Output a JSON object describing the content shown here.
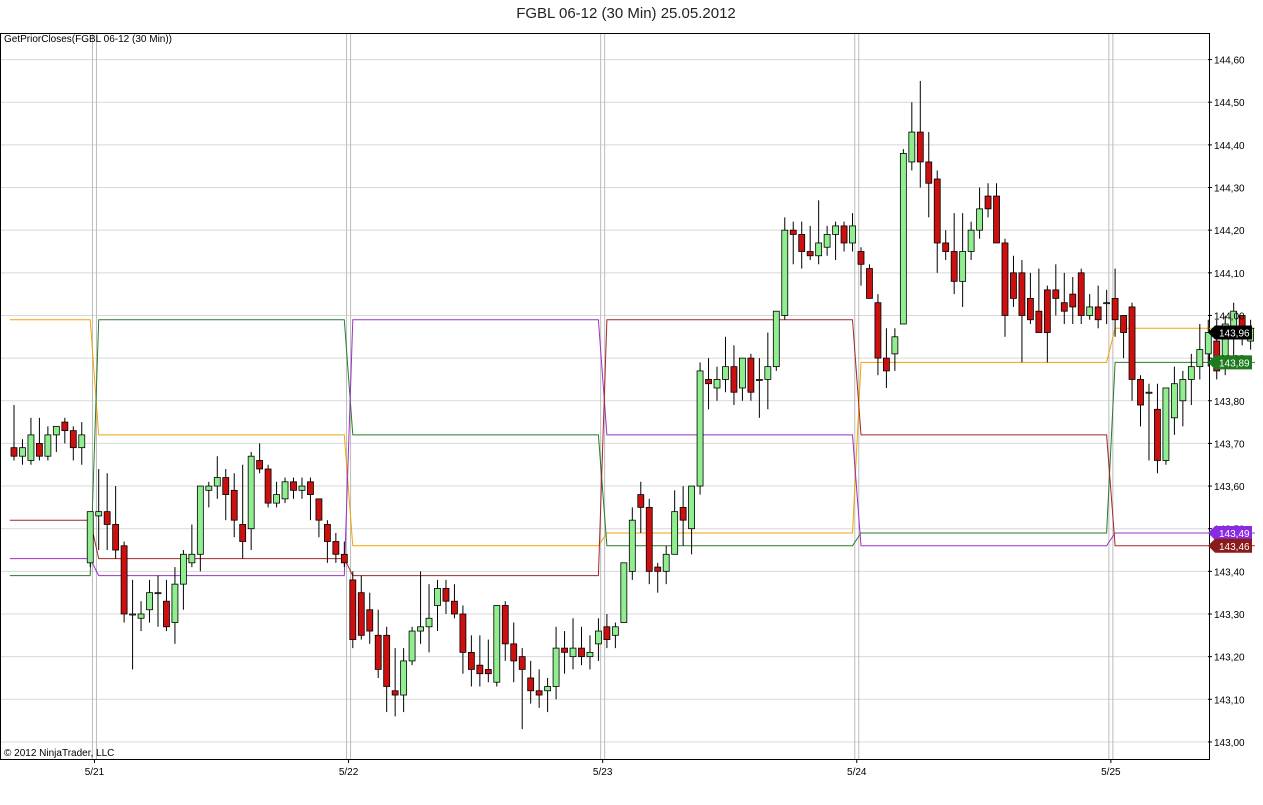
{
  "chart_data": {
    "type": "candlestick",
    "title": "FGBL 06-12 (30 Min)  25.05.2012",
    "indicator_label": "GetPriorCloses(FGBL 06-12 (30 Min))",
    "copyright": "© 2012 NinjaTrader, LLC",
    "ylim": [
      142.96,
      144.66
    ],
    "y_ticks": [
      {
        "v": 143.0,
        "label": "143,00"
      },
      {
        "v": 143.1,
        "label": "143,10"
      },
      {
        "v": 143.2,
        "label": "143,20"
      },
      {
        "v": 143.3,
        "label": "143,30"
      },
      {
        "v": 143.4,
        "label": "143,40"
      },
      {
        "v": 143.5,
        "label": "143,50"
      },
      {
        "v": 143.6,
        "label": "143,60"
      },
      {
        "v": 143.7,
        "label": "143,70"
      },
      {
        "v": 143.8,
        "label": "143,80"
      },
      {
        "v": 143.9,
        "label": "143,90"
      },
      {
        "v": 144.0,
        "label": "144,00"
      },
      {
        "v": 144.1,
        "label": "144,10"
      },
      {
        "v": 144.2,
        "label": "144,20"
      },
      {
        "v": 144.3,
        "label": "144,30"
      },
      {
        "v": 144.4,
        "label": "144,40"
      },
      {
        "v": 144.5,
        "label": "144,50"
      },
      {
        "v": 144.6,
        "label": "144,60"
      }
    ],
    "day_separators": [
      {
        "bar": 9.5,
        "label": "5/21"
      },
      {
        "bar": 39.5,
        "label": "5/22"
      },
      {
        "bar": 69.5,
        "label": "5/23"
      },
      {
        "bar": 99.5,
        "label": "5/24"
      },
      {
        "bar": 129.5,
        "label": "5/25"
      }
    ],
    "candles": [
      [
        143.69,
        143.79,
        143.66,
        143.67
      ],
      [
        143.67,
        143.71,
        143.65,
        143.69
      ],
      [
        143.66,
        143.76,
        143.65,
        143.72
      ],
      [
        143.7,
        143.76,
        143.66,
        143.67
      ],
      [
        143.67,
        143.74,
        143.66,
        143.72
      ],
      [
        143.72,
        143.74,
        143.68,
        143.74
      ],
      [
        143.75,
        143.76,
        143.7,
        143.73
      ],
      [
        143.73,
        143.74,
        143.66,
        143.69
      ],
      [
        143.69,
        143.75,
        143.65,
        143.72
      ],
      [
        143.42,
        143.54,
        143.41,
        143.54
      ],
      [
        143.53,
        143.64,
        143.45,
        143.54
      ],
      [
        143.54,
        143.63,
        143.45,
        143.51
      ],
      [
        143.51,
        143.6,
        143.43,
        143.45
      ],
      [
        143.46,
        143.47,
        143.28,
        143.3
      ],
      [
        143.3,
        143.38,
        143.17,
        143.3
      ],
      [
        143.29,
        143.33,
        143.26,
        143.3
      ],
      [
        143.31,
        143.38,
        143.28,
        143.35
      ],
      [
        143.35,
        143.39,
        143.27,
        143.35
      ],
      [
        143.33,
        143.38,
        143.26,
        143.27
      ],
      [
        143.28,
        143.41,
        143.23,
        143.37
      ],
      [
        143.37,
        143.45,
        143.31,
        143.44
      ],
      [
        143.42,
        143.51,
        143.41,
        143.44
      ],
      [
        143.44,
        143.59,
        143.4,
        143.6
      ],
      [
        143.59,
        143.61,
        143.55,
        143.6
      ],
      [
        143.6,
        143.67,
        143.57,
        143.62
      ],
      [
        143.62,
        143.64,
        143.52,
        143.58
      ],
      [
        143.59,
        143.63,
        143.48,
        143.52
      ],
      [
        143.51,
        143.65,
        143.43,
        143.47
      ],
      [
        143.5,
        143.68,
        143.45,
        143.67
      ],
      [
        143.66,
        143.7,
        143.63,
        143.64
      ],
      [
        143.64,
        143.65,
        143.55,
        143.56
      ],
      [
        143.56,
        143.61,
        143.55,
        143.58
      ],
      [
        143.57,
        143.62,
        143.56,
        143.61
      ],
      [
        143.61,
        143.62,
        143.57,
        143.59
      ],
      [
        143.59,
        143.62,
        143.57,
        143.6
      ],
      [
        143.61,
        143.62,
        143.52,
        143.58
      ],
      [
        143.57,
        143.57,
        143.48,
        143.52
      ],
      [
        143.51,
        143.52,
        143.42,
        143.47
      ],
      [
        143.47,
        143.49,
        143.42,
        143.44
      ],
      [
        143.44,
        143.47,
        143.41,
        143.42
      ],
      [
        143.38,
        143.4,
        143.22,
        143.24
      ],
      [
        143.35,
        143.39,
        143.24,
        143.25
      ],
      [
        143.31,
        143.35,
        143.23,
        143.26
      ],
      [
        143.25,
        143.31,
        143.15,
        143.17
      ],
      [
        143.25,
        143.27,
        143.07,
        143.13
      ],
      [
        143.12,
        143.22,
        143.06,
        143.11
      ],
      [
        143.11,
        143.22,
        143.07,
        143.19
      ],
      [
        143.19,
        143.27,
        143.18,
        143.26
      ],
      [
        143.26,
        143.4,
        143.23,
        143.27
      ],
      [
        143.27,
        143.37,
        143.21,
        143.29
      ],
      [
        143.32,
        143.38,
        143.26,
        143.36
      ],
      [
        143.36,
        143.38,
        143.3,
        143.33
      ],
      [
        143.33,
        143.37,
        143.29,
        143.3
      ],
      [
        143.3,
        143.32,
        143.16,
        143.21
      ],
      [
        143.21,
        143.25,
        143.13,
        143.17
      ],
      [
        143.18,
        143.25,
        143.13,
        143.16
      ],
      [
        143.17,
        143.24,
        143.14,
        143.16
      ],
      [
        143.14,
        143.32,
        143.13,
        143.32
      ],
      [
        143.32,
        143.33,
        143.19,
        143.23
      ],
      [
        143.23,
        143.28,
        143.14,
        143.19
      ],
      [
        143.2,
        143.22,
        143.03,
        143.17
      ],
      [
        143.15,
        143.19,
        143.09,
        143.12
      ],
      [
        143.12,
        143.17,
        143.08,
        143.11
      ],
      [
        143.12,
        143.15,
        143.07,
        143.13
      ],
      [
        143.13,
        143.27,
        143.1,
        143.22
      ],
      [
        143.22,
        143.26,
        143.16,
        143.21
      ],
      [
        143.2,
        143.29,
        143.17,
        143.22
      ],
      [
        143.22,
        143.27,
        143.18,
        143.2
      ],
      [
        143.2,
        143.25,
        143.17,
        143.21
      ],
      [
        143.23,
        143.29,
        143.19,
        143.26
      ],
      [
        143.27,
        143.3,
        143.22,
        143.24
      ],
      [
        143.25,
        143.28,
        143.22,
        143.27
      ],
      [
        143.28,
        143.42,
        143.28,
        143.42
      ],
      [
        143.4,
        143.55,
        143.38,
        143.52
      ],
      [
        143.58,
        143.61,
        143.49,
        143.55
      ],
      [
        143.55,
        143.57,
        143.37,
        143.4
      ],
      [
        143.41,
        143.42,
        143.35,
        143.4
      ],
      [
        143.4,
        143.46,
        143.37,
        143.44
      ],
      [
        143.44,
        143.59,
        143.44,
        143.54
      ],
      [
        143.55,
        143.6,
        143.46,
        143.52
      ],
      [
        143.5,
        143.58,
        143.44,
        143.6
      ],
      [
        143.6,
        143.89,
        143.58,
        143.87
      ],
      [
        143.85,
        143.9,
        143.78,
        143.84
      ],
      [
        143.83,
        143.88,
        143.8,
        143.85
      ],
      [
        143.85,
        143.95,
        143.82,
        143.88
      ],
      [
        143.88,
        143.93,
        143.79,
        143.82
      ],
      [
        143.83,
        143.9,
        143.8,
        143.9
      ],
      [
        143.9,
        143.91,
        143.8,
        143.82
      ],
      [
        143.85,
        143.9,
        143.76,
        143.85
      ],
      [
        143.85,
        143.96,
        143.78,
        143.88
      ],
      [
        143.88,
        144.01,
        143.87,
        144.01
      ],
      [
        144.0,
        144.23,
        143.99,
        144.2
      ],
      [
        144.2,
        144.22,
        144.12,
        144.19
      ],
      [
        144.19,
        144.22,
        144.11,
        144.15
      ],
      [
        144.15,
        144.21,
        144.13,
        144.14
      ],
      [
        144.14,
        144.27,
        144.12,
        144.17
      ],
      [
        144.16,
        144.21,
        144.14,
        144.19
      ],
      [
        144.19,
        144.22,
        144.13,
        144.21
      ],
      [
        144.21,
        144.22,
        144.15,
        144.17
      ],
      [
        144.17,
        144.24,
        144.15,
        144.21
      ],
      [
        144.15,
        144.16,
        144.07,
        144.12
      ],
      [
        144.11,
        144.12,
        144.04,
        144.04
      ],
      [
        144.03,
        144.05,
        143.86,
        143.9
      ],
      [
        143.9,
        143.97,
        143.83,
        143.87
      ],
      [
        143.91,
        143.97,
        143.87,
        143.95
      ],
      [
        143.98,
        144.39,
        143.98,
        144.38
      ],
      [
        144.36,
        144.5,
        144.34,
        144.43
      ],
      [
        144.43,
        144.55,
        144.3,
        144.36
      ],
      [
        144.36,
        144.43,
        144.23,
        144.31
      ],
      [
        144.32,
        144.34,
        144.1,
        144.17
      ],
      [
        144.17,
        144.2,
        144.13,
        144.15
      ],
      [
        144.15,
        144.24,
        144.05,
        144.08
      ],
      [
        144.08,
        144.24,
        144.02,
        144.15
      ],
      [
        144.15,
        144.22,
        144.13,
        144.2
      ],
      [
        144.2,
        144.3,
        144.18,
        144.25
      ],
      [
        144.28,
        144.31,
        144.23,
        144.25
      ],
      [
        144.28,
        144.31,
        144.2,
        144.17
      ],
      [
        144.17,
        144.18,
        143.95,
        144.0
      ],
      [
        144.1,
        144.14,
        144.02,
        144.04
      ],
      [
        144.1,
        144.13,
        143.89,
        144.0
      ],
      [
        144.04,
        144.1,
        143.98,
        143.99
      ],
      [
        144.01,
        144.11,
        143.96,
        143.96
      ],
      [
        144.06,
        144.07,
        143.89,
        143.96
      ],
      [
        144.06,
        144.12,
        144.0,
        144.04
      ],
      [
        144.03,
        144.1,
        143.98,
        144.01
      ],
      [
        144.05,
        144.09,
        143.98,
        144.02
      ],
      [
        144.1,
        144.11,
        143.98,
        144.0
      ],
      [
        144.0,
        144.05,
        143.99,
        144.02
      ],
      [
        144.02,
        144.07,
        143.97,
        143.99
      ],
      [
        144.03,
        144.06,
        143.98,
        144.03
      ],
      [
        144.04,
        144.11,
        143.95,
        143.99
      ],
      [
        144.0,
        144.0,
        143.9,
        143.96
      ],
      [
        144.02,
        144.03,
        143.8,
        143.85
      ],
      [
        143.85,
        143.86,
        143.74,
        143.79
      ],
      [
        143.82,
        143.84,
        143.66,
        143.82
      ],
      [
        143.78,
        143.84,
        143.63,
        143.66
      ],
      [
        143.66,
        143.76,
        143.65,
        143.83
      ],
      [
        143.76,
        143.88,
        143.72,
        143.84
      ],
      [
        143.8,
        143.87,
        143.74,
        143.85
      ],
      [
        143.85,
        143.91,
        143.79,
        143.88
      ],
      [
        143.88,
        143.98,
        143.85,
        143.92
      ],
      [
        143.91,
        143.99,
        143.88,
        143.96
      ],
      [
        143.94,
        143.99,
        143.85,
        143.87
      ],
      [
        143.88,
        144.0,
        143.86,
        143.98
      ],
      [
        143.97,
        144.03,
        143.9,
        144.01
      ],
      [
        144.0,
        144.0,
        143.93,
        143.97
      ],
      [
        143.94,
        143.99,
        143.92,
        143.97
      ]
    ],
    "prior_close_lines": [
      {
        "name": "orange",
        "color": "#f4a300",
        "levels": [
          143.99,
          143.72,
          143.46,
          143.49,
          143.89,
          143.97
        ]
      },
      {
        "name": "green",
        "color": "#2a7a2a",
        "levels": [
          143.39,
          143.99,
          143.72,
          143.46,
          143.49,
          143.89
        ]
      },
      {
        "name": "purple",
        "color": "#9b30c8",
        "levels": [
          143.43,
          143.39,
          143.99,
          143.72,
          143.46,
          143.49
        ]
      },
      {
        "name": "maroon",
        "color": "#a02828",
        "levels": [
          143.52,
          143.43,
          143.39,
          143.99,
          143.72,
          143.46
        ]
      }
    ],
    "price_flags": [
      {
        "label": "143,96",
        "v": 143.96,
        "color": "#000000"
      },
      {
        "label": "143,89",
        "v": 143.89,
        "color": "#1e7a1e"
      },
      {
        "label": "143,49",
        "v": 143.49,
        "color": "#8a2be2"
      },
      {
        "label": "143,46",
        "v": 143.46,
        "color": "#8b1a1a"
      }
    ],
    "colors": {
      "up": "#90ee90",
      "down": "#cc1010",
      "border": "#000000",
      "grid": "#d8d8d8",
      "separator": "#bcbcbc"
    }
  }
}
